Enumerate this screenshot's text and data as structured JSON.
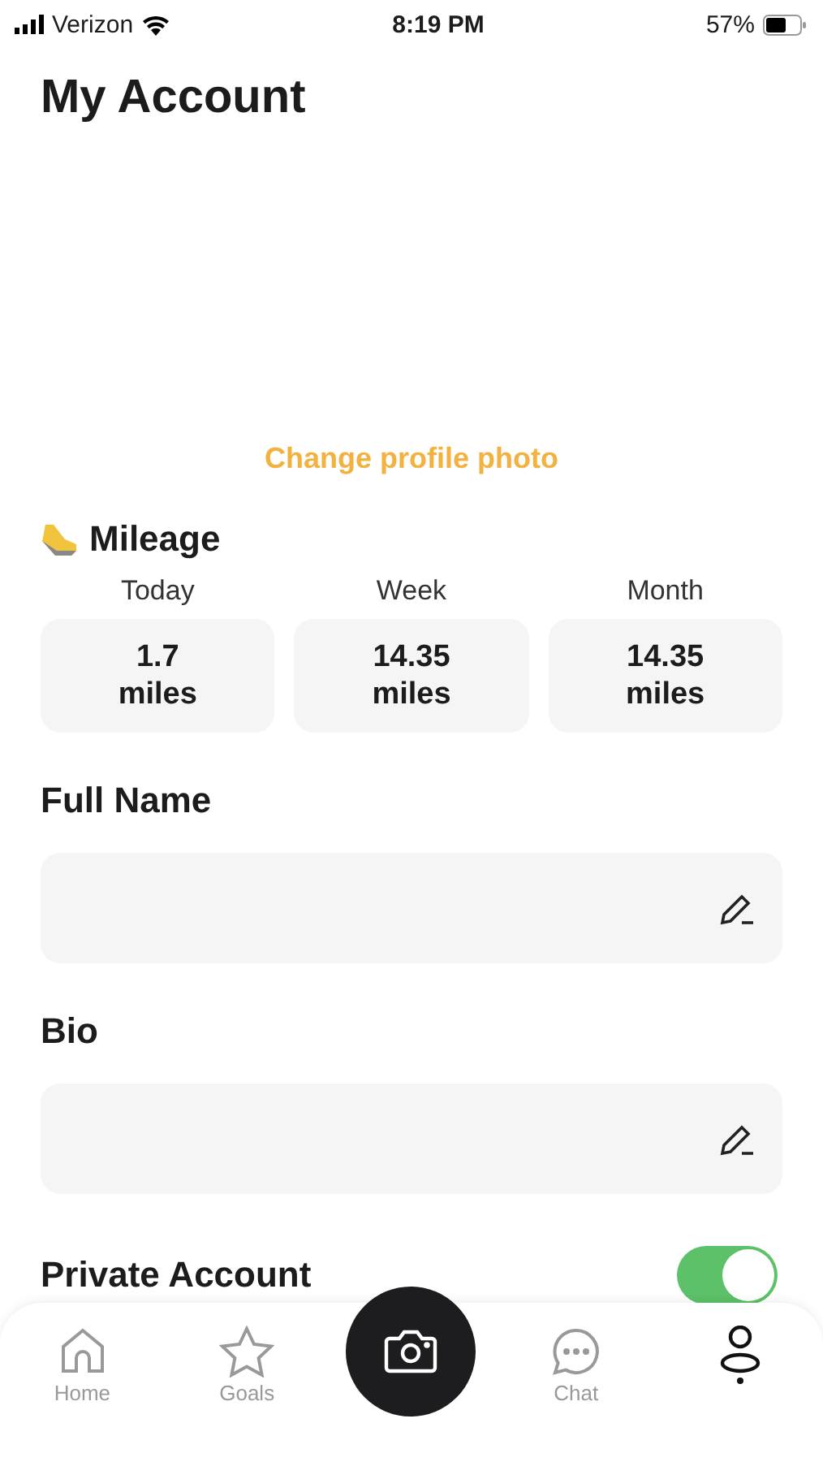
{
  "status_bar": {
    "carrier": "Verizon",
    "time": "8:19 PM",
    "battery": "57%"
  },
  "title": "My Account",
  "change_photo": "Change profile photo",
  "mileage": {
    "title": "Mileage",
    "stats": [
      {
        "label": "Today",
        "value": "1.7",
        "unit": "miles"
      },
      {
        "label": "Week",
        "value": "14.35",
        "unit": "miles"
      },
      {
        "label": "Month",
        "value": "14.35",
        "unit": "miles"
      }
    ]
  },
  "fields": [
    {
      "label": "Full Name"
    },
    {
      "label": "Bio"
    }
  ],
  "private_account": {
    "label": "Private Account",
    "on": true
  },
  "nav": [
    {
      "kind": "home",
      "label": "Home",
      "selected": false
    },
    {
      "kind": "goals",
      "label": "Goals",
      "selected": false
    },
    {
      "kind": "camera",
      "selected": false
    },
    {
      "kind": "chat",
      "label": "Chat",
      "selected": false
    },
    {
      "kind": "profile",
      "selected": true
    }
  ]
}
